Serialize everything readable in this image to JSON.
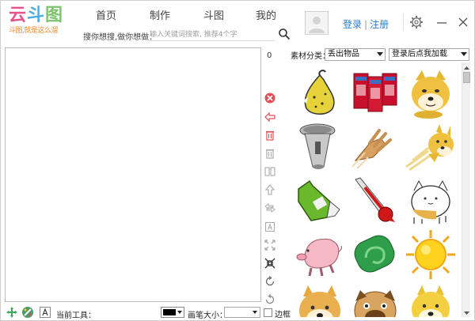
{
  "logo": {
    "title_parts": [
      "云",
      "斗",
      "图"
    ],
    "subtitle": "斗图,就是这么溜"
  },
  "nav": [
    "首页",
    "制作",
    "斗图",
    "我的"
  ],
  "search": {
    "label": "搜你想搜,做你想做：",
    "placeholder": "输入关键词搜索, 推荐4个字"
  },
  "account": {
    "login": "登录",
    "register": "注册"
  },
  "canvas": {
    "counter": "0"
  },
  "panel": {
    "category_label": "素材分类：",
    "category_value": "丢出物品",
    "action_value": "登录后点我加载"
  },
  "stickers": [
    "pear",
    "red-boxes",
    "doge-face",
    "microphone",
    "flying-hand",
    "flying-doge",
    "green-bottle",
    "thermometer",
    "cat-blob",
    "pig",
    "green-soap",
    "sun",
    "doge-head",
    "pug",
    "yellow-dog"
  ],
  "bottom": {
    "current_tool_label": "当前工具：",
    "pen_color": "#000000",
    "pen_size_label": "画笔大小：",
    "border_label": "边框"
  },
  "colors": {
    "accent": "#2c7cd2",
    "tool_red": "#e0505a"
  }
}
